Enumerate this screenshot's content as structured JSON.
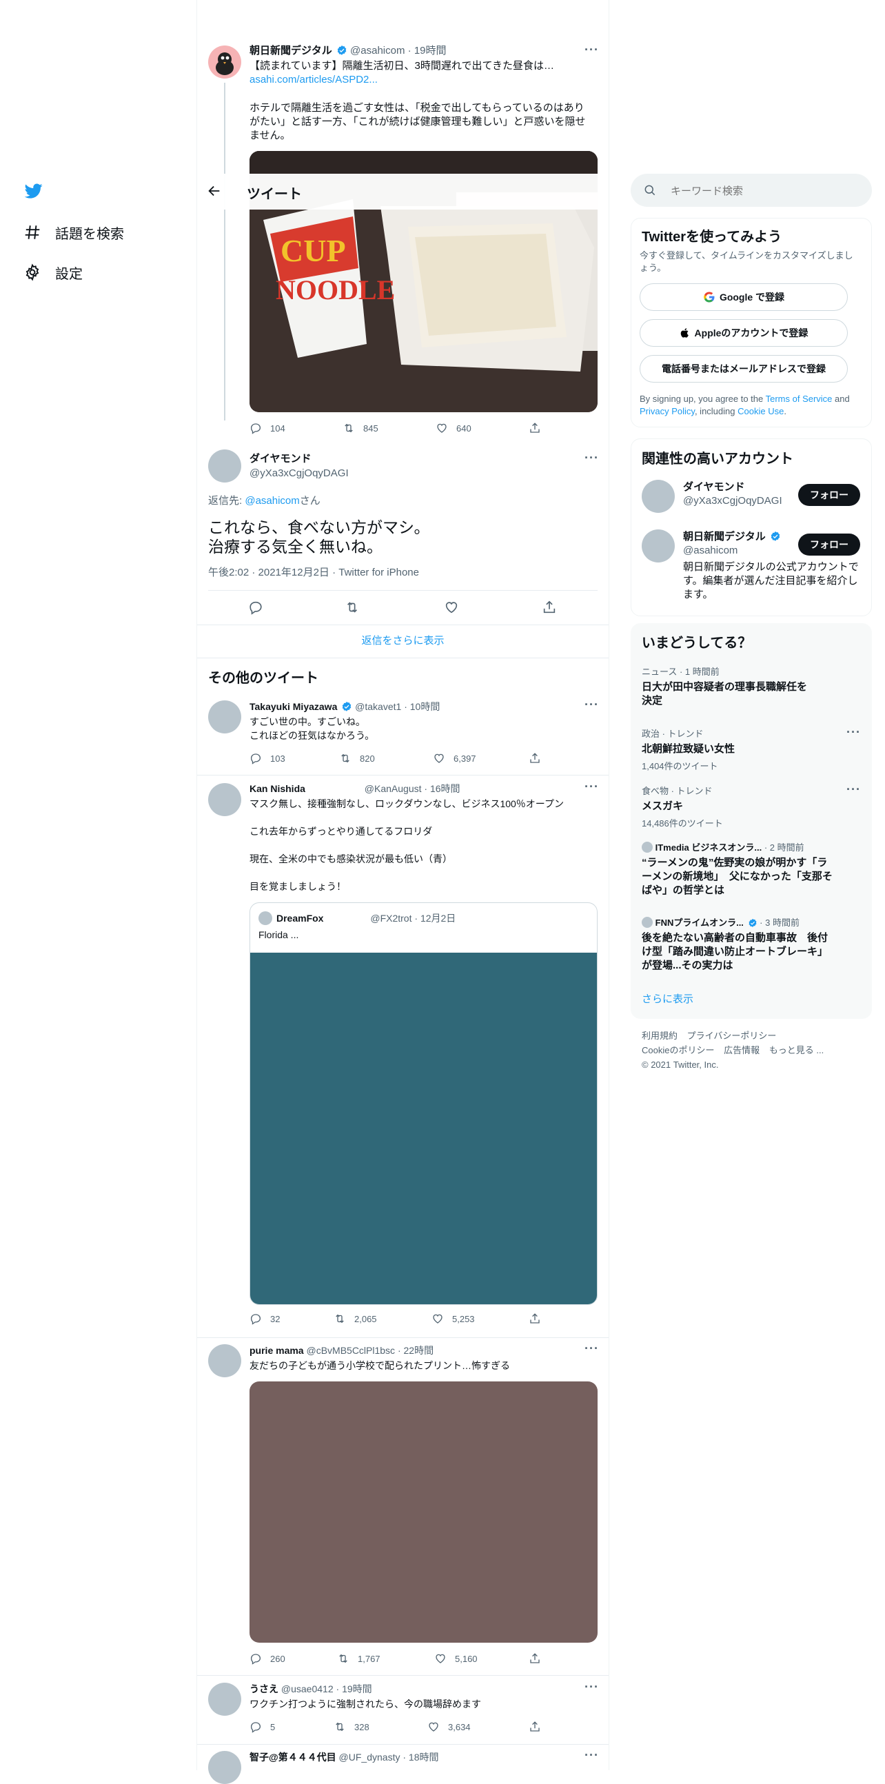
{
  "nav": {
    "explore_label": "話題を検索",
    "settings_label": "設定"
  },
  "header": {
    "title": "ツイート"
  },
  "parent_tweet": {
    "name": "朝日新聞デジタル",
    "handle": "@asahicom",
    "time": "19時間",
    "line1": "【読まれています】隔離生活初日、3時間遅れで出てきた昼食は…",
    "link": "asahi.com/articles/ASPD2...",
    "body": "ホテルで隔離生活を過ごす女性は、「税金で出してもらっているのはありがたい」と話す一方、「これが続けば健康管理も難しい」と戸惑いを隠せません。",
    "replies": "104",
    "retweets": "845",
    "likes": "640"
  },
  "main_tweet": {
    "name": "ダイヤモンド",
    "handle": "@yXa3xCgjOqyDAGI",
    "reply_prefix": "返信先: ",
    "reply_to": "@asahicom",
    "reply_suffix": "さん",
    "text_line1": "これなら、食べない方がマシ。",
    "text_line2": "治療する気全く無いね。",
    "meta": "午後2:02 · 2021年12月2日 · Twitter for iPhone"
  },
  "show_more_replies": "返信をさらに表示",
  "more_tweets_heading": "その他のツイート",
  "tweets": [
    {
      "name": "Takayuki Miyazawa",
      "handle": "@takavet1",
      "time": "10時間",
      "line1": "すごい世の中。すごいね。",
      "line2": "これほどの狂気はなかろう。",
      "replies": "103",
      "retweets": "820",
      "likes": "6,397"
    },
    {
      "name": "Kan Nishida",
      "handle": "@KanAugust",
      "time": "16時間",
      "line1": "マスク無し、接種強制なし、ロックダウンなし、ビジネス100％オープン",
      "line2": "これ去年からずっとやり通してるフロリダ",
      "line3": "現在、全米の中でも感染状況が最も低い（青）",
      "line4": "目を覚ましましょう！",
      "quote_name": "DreamFox",
      "quote_handle": "@FX2trot",
      "quote_time": "12月2日",
      "quote_text": "Florida ...",
      "replies": "32",
      "retweets": "2,065",
      "likes": "5,253"
    },
    {
      "name": "purie mama",
      "handle": "@cBvMB5CclPl1bsc",
      "time": "22時間",
      "line1": "友だちの子どもが通う小学校で配られたプリント…怖すぎる",
      "replies": "260",
      "retweets": "1,767",
      "likes": "5,160"
    },
    {
      "name": "うさえ",
      "handle": "@usae0412",
      "time": "19時間",
      "line1": "ワクチン打つように強制されたら、今の職場辞めます",
      "replies": "5",
      "retweets": "328",
      "likes": "3,634"
    },
    {
      "name": "智子@第４４４代目",
      "handle": "@UF_dynasty",
      "time": "18時間"
    }
  ],
  "search": {
    "placeholder": "キーワード検索"
  },
  "signup": {
    "title": "Twitterを使ってみよう",
    "subtitle": "今すぐ登録して、タイムラインをカスタマイズしましょう。",
    "google_label": "Google で登録",
    "apple_label": "Appleのアカウントで登録",
    "phone_label": "電話番号またはメールアドレスで登録",
    "legal_prefix": "By signing up, you agree to the ",
    "terms": "Terms of Service",
    "and": " and ",
    "privacy": "Privacy Policy",
    "including": ", including ",
    "cookie": "Cookie Use",
    "period": "."
  },
  "relevant": {
    "title": "関連性の高いアカウント",
    "accounts": [
      {
        "name": "ダイヤモンド",
        "handle": "@yXa3xCgjOqyDAGI",
        "follow": "フォロー"
      },
      {
        "name": "朝日新聞デジタル",
        "handle": "@asahicom",
        "follow": "フォロー",
        "bio": "朝日新聞デジタルの公式アカウントです。編集者が選んだ注目記事を紹介します。"
      }
    ]
  },
  "trends": {
    "title": "いまどうしてる？",
    "items": [
      {
        "meta": "ニュース · 1 時間前",
        "title": "日大が田中容疑者の理事長職解任を決定"
      },
      {
        "meta": "政治 · トレンド",
        "title": "北朝鮮拉致疑い女性",
        "count": "1,404件のツイート"
      },
      {
        "meta": "食べ物 · トレンド",
        "title": "メスガキ",
        "count": "14,486件のツイート"
      },
      {
        "source": "ITmedia ビジネスオンラ...",
        "time": "· 2 時間前",
        "title": "“ラーメンの鬼”佐野実の娘が明かす「ラーメンの新境地」　父になかった「支那そばや」の哲学とは"
      },
      {
        "source": "FNNプライムオンラ...",
        "time": "· 3 時間前",
        "title": "後を絶たない高齢者の自動車事故　後付け型「踏み間違い防止オートブレーキ」が登場...その実力は"
      }
    ],
    "show_more": "さらに表示"
  },
  "footer": {
    "terms": "利用規約",
    "privacy": "プライバシーポリシー",
    "cookie": "Cookieのポリシー",
    "ads": "広告情報",
    "more": "もっと見る ...",
    "copyright": "© 2021 Twitter, Inc."
  },
  "colors": {
    "accent": "#1d9bf0",
    "media_quote": "#306878",
    "media_print": "#755f5d"
  }
}
